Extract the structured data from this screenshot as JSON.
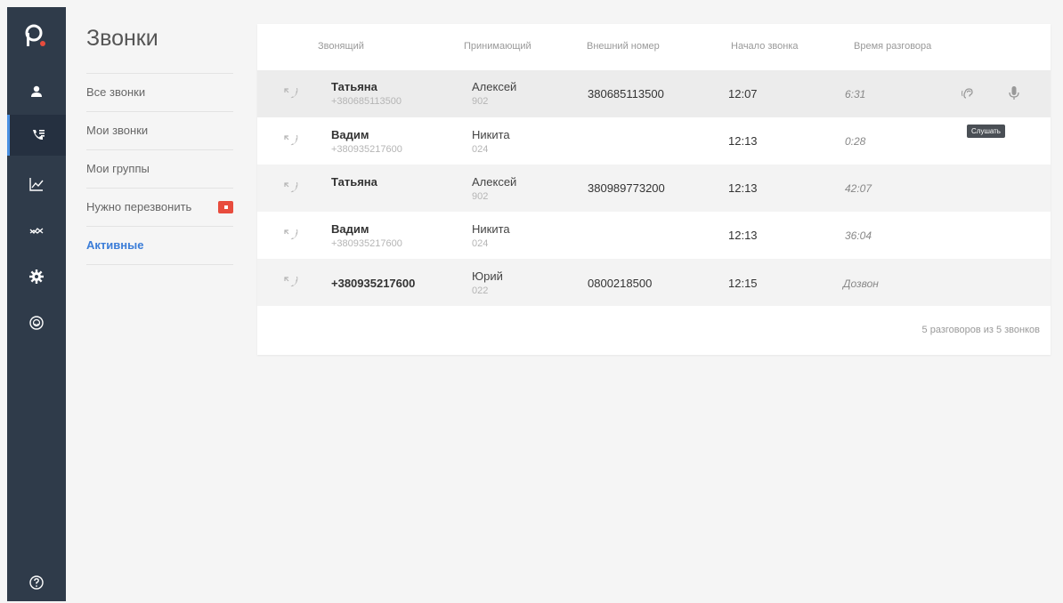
{
  "sidebar": {
    "logo_letter": "p",
    "items": [
      {
        "icon": "user-icon",
        "active": false
      },
      {
        "icon": "calls-list-icon",
        "active": true
      },
      {
        "icon": "line-chart-icon",
        "active": false
      },
      {
        "icon": "trend-icon",
        "active": false
      },
      {
        "icon": "gear-icon",
        "active": false
      },
      {
        "icon": "face-icon",
        "active": false
      }
    ],
    "help_icon": "question-circle-icon"
  },
  "subnav": {
    "title": "Звонки",
    "items": [
      {
        "label": "Все звонки"
      },
      {
        "label": "Мои звонки"
      },
      {
        "label": "Мои группы"
      },
      {
        "label": "Нужно перезвонить",
        "badge": true
      },
      {
        "label": "Активные",
        "active": true
      }
    ]
  },
  "table": {
    "headers": {
      "caller": "Звонящий",
      "receiver": "Принимающий",
      "external": "Внешний номер",
      "start": "Начало звонка",
      "duration": "Время разговора"
    },
    "rows": [
      {
        "caller_name": "Татьяна",
        "caller_phone": "+380685113500",
        "receiver_name": "Алексей",
        "receiver_ext": "902",
        "external": "380685113500",
        "start": "12:07",
        "duration": "6:31",
        "show_actions": true
      },
      {
        "caller_name": "Вадим",
        "caller_phone": "+380935217600",
        "receiver_name": "Никита",
        "receiver_ext": "024",
        "external": "",
        "start": "12:13",
        "duration": "0:28"
      },
      {
        "caller_name": "Татьяна",
        "caller_phone": "",
        "receiver_name": "Алексей",
        "receiver_ext": "902",
        "external": "380989773200",
        "start": "12:13",
        "duration": "42:07"
      },
      {
        "caller_name": "Вадим",
        "caller_phone": "+380935217600",
        "receiver_name": "Никита",
        "receiver_ext": "024",
        "external": "",
        "start": "12:13",
        "duration": "36:04"
      },
      {
        "caller_name": "+380935217600",
        "caller_phone": "",
        "receiver_name": "Юрий",
        "receiver_ext": "022",
        "external": "0800218500",
        "start": "12:15",
        "duration": "Дозвон"
      }
    ],
    "tooltip": "Слушать",
    "footer": "5 разговоров из 5 звонков"
  },
  "colors": {
    "sidebar_bg": "#2f3b4a",
    "accent": "#3b7dd8",
    "logo_dot": "#e84c3d",
    "badge": "#e84c3d"
  }
}
